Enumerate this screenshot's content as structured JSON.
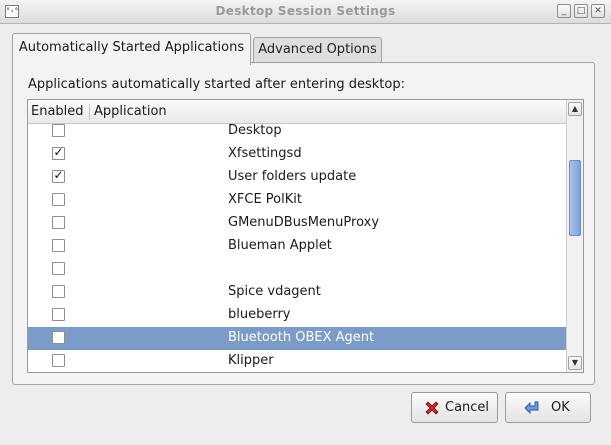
{
  "window": {
    "title": "Desktop Session Settings",
    "app_icon_text": "°‹°"
  },
  "tabs": [
    {
      "label": "Automatically Started Applications",
      "active": true
    },
    {
      "label": "Advanced Options",
      "active": false
    }
  ],
  "description": "Applications automatically started after entering desktop:",
  "table": {
    "columns": [
      "Enabled",
      "Application"
    ],
    "rows": [
      {
        "enabled": false,
        "application": "Desktop"
      },
      {
        "enabled": true,
        "application": "Xfsettingsd"
      },
      {
        "enabled": true,
        "application": "User folders update"
      },
      {
        "enabled": false,
        "application": "XFCE PolKit"
      },
      {
        "enabled": false,
        "application": "GMenuDBusMenuProxy"
      },
      {
        "enabled": false,
        "application": "Blueman Applet"
      },
      {
        "enabled": false,
        "application": ""
      },
      {
        "enabled": false,
        "application": "Spice vdagent"
      },
      {
        "enabled": false,
        "application": "blueberry"
      },
      {
        "enabled": false,
        "application": "Bluetooth OBEX Agent",
        "selected": true
      },
      {
        "enabled": false,
        "application": "Klipper"
      }
    ]
  },
  "buttons": {
    "cancel_label": "Cancel",
    "ok_label": "OK"
  },
  "icons": {
    "cancel": "cancel-x-icon",
    "ok": "ok-arrow-icon"
  },
  "colors": {
    "selection": "#7b9bc9",
    "scroll_thumb": "#8fb0e4",
    "cancel_icon": "#d0232a",
    "ok_icon": "#3f73c9"
  }
}
